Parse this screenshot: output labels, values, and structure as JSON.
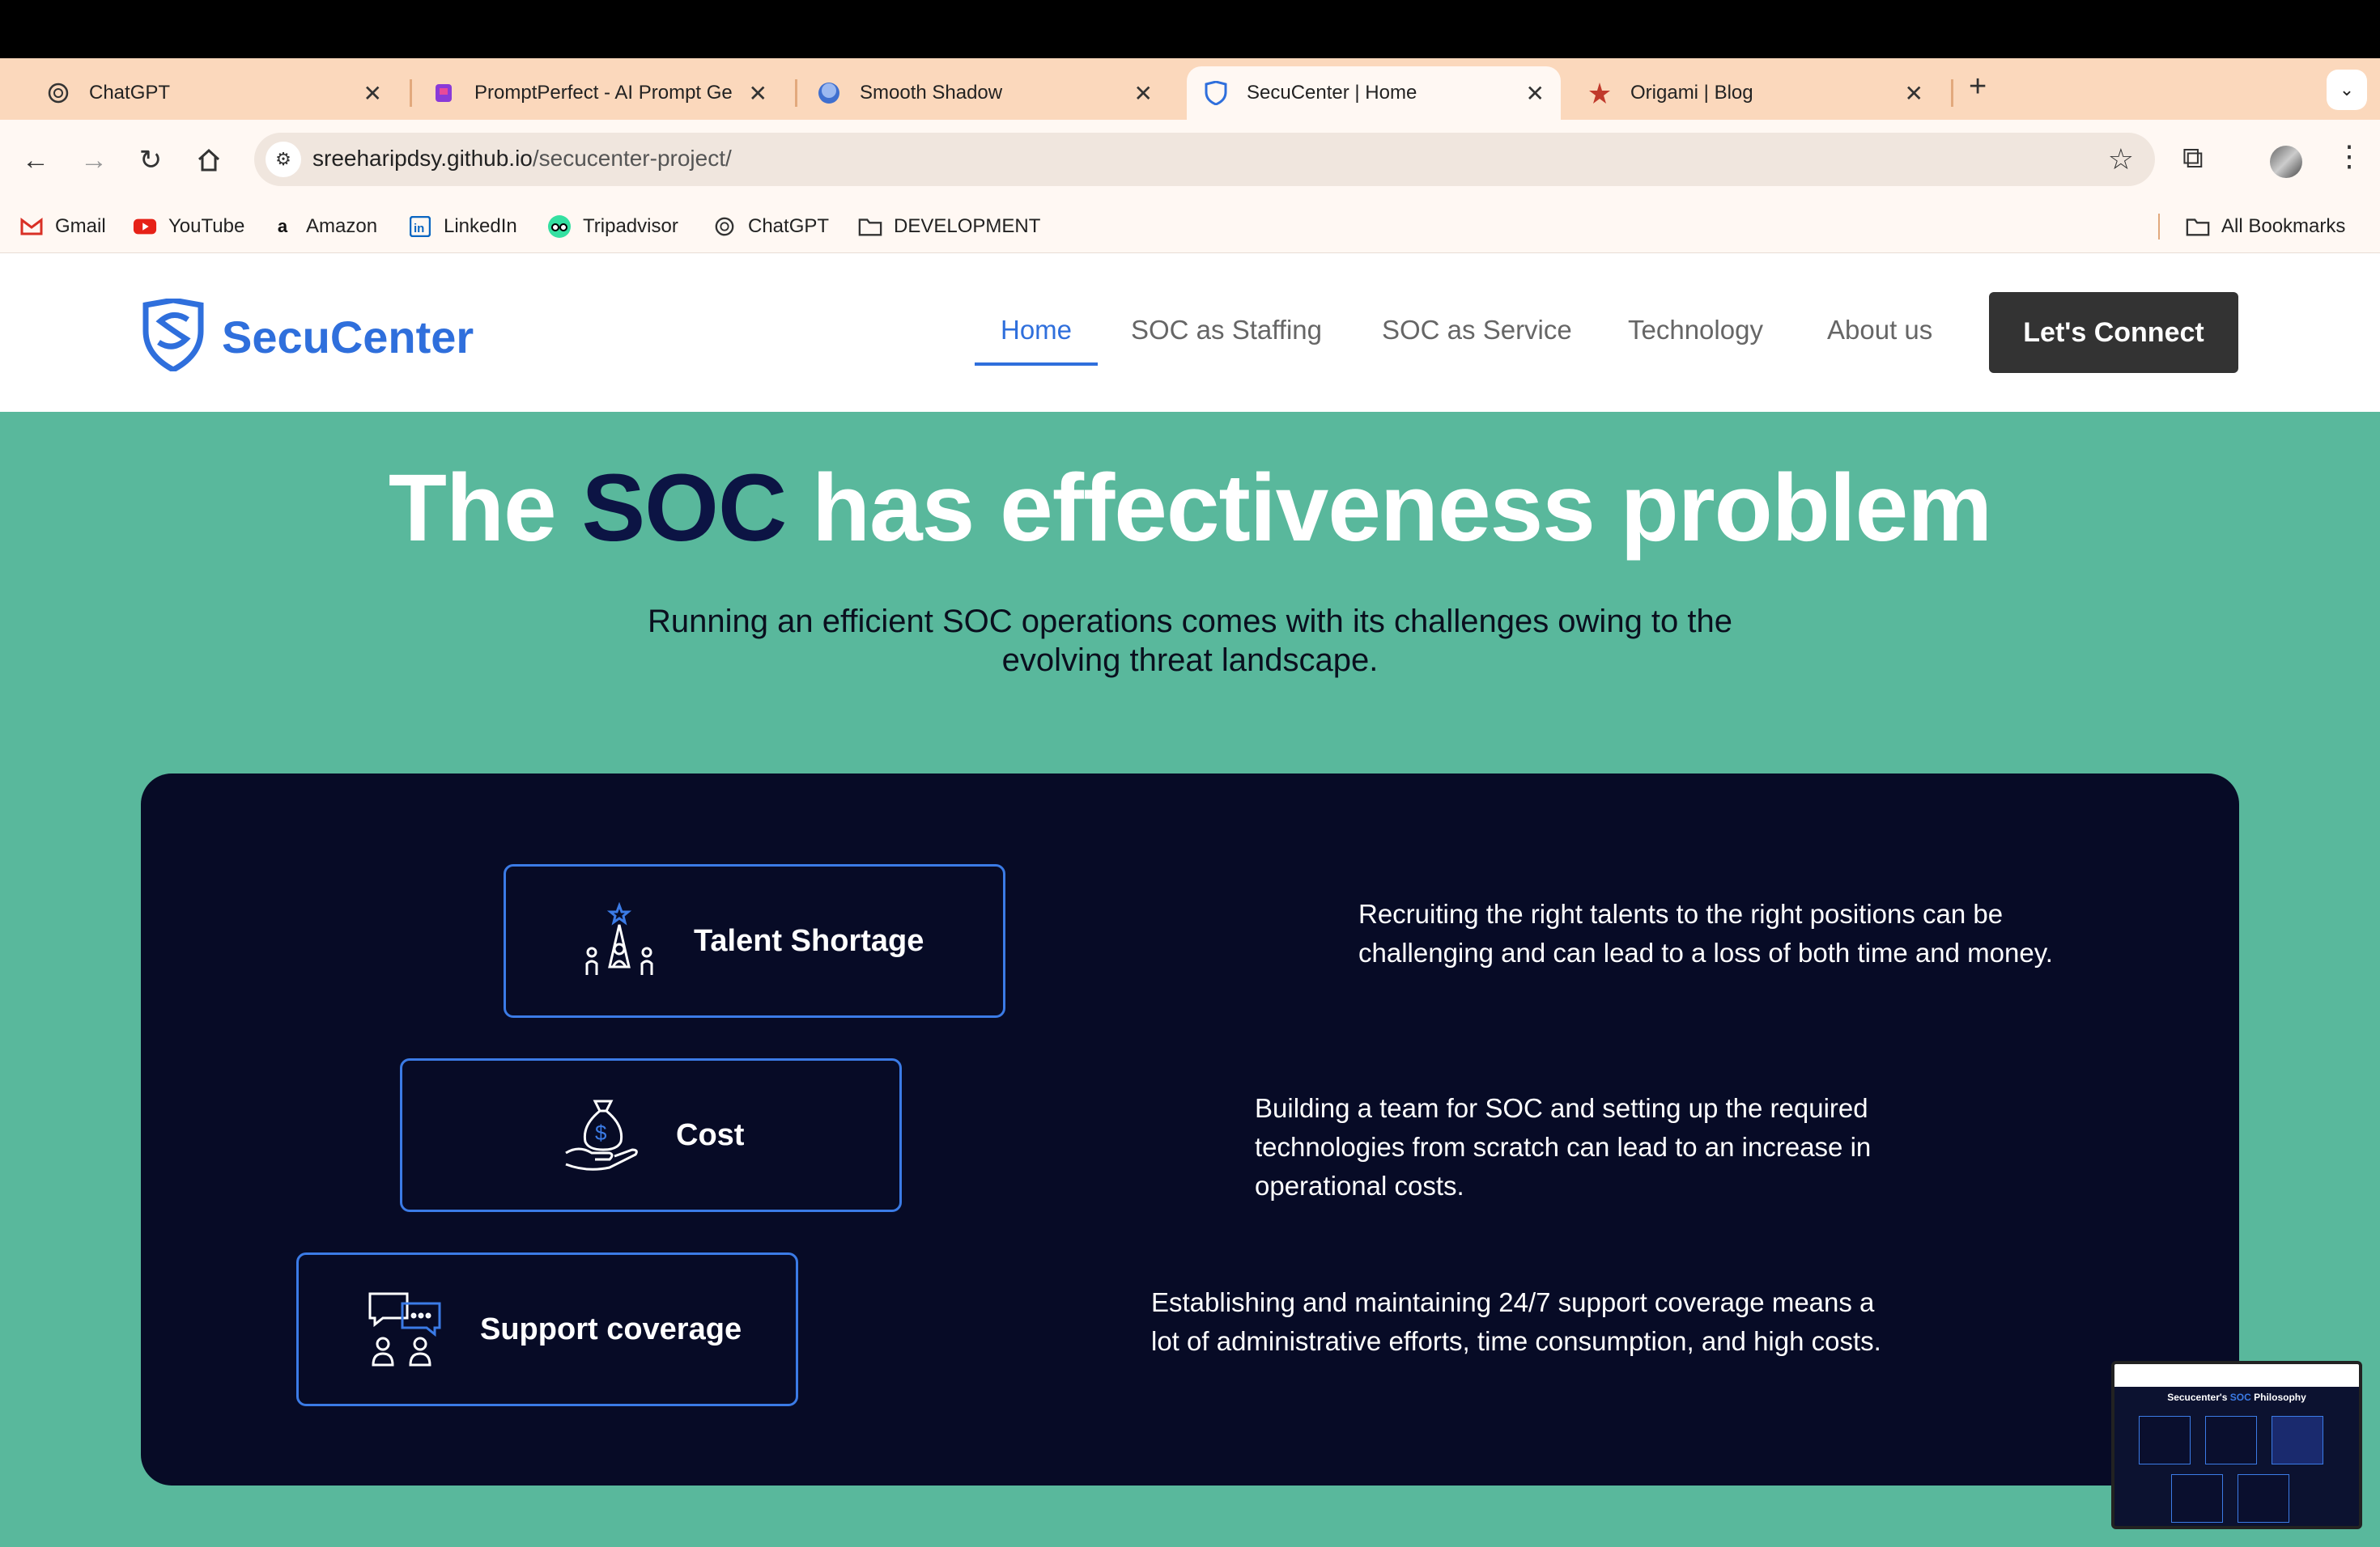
{
  "browser": {
    "tabs": [
      {
        "title": "ChatGPT",
        "icon": "chatgpt-icon"
      },
      {
        "title": "PromptPerfect - AI Prompt Ge",
        "icon": "promptperfect-icon"
      },
      {
        "title": "Smooth Shadow",
        "icon": "smooth-shadow-icon"
      },
      {
        "title": "SecuCenter | Home",
        "icon": "secucenter-icon",
        "active": true
      },
      {
        "title": "Origami | Blog",
        "icon": "origami-icon"
      }
    ],
    "url_host": "sreeharipdsy.github.io",
    "url_path": "/secucenter-project/",
    "bookmarks": [
      {
        "label": "Gmail",
        "icon": "gmail-icon"
      },
      {
        "label": "YouTube",
        "icon": "youtube-icon"
      },
      {
        "label": "Amazon",
        "icon": "amazon-icon"
      },
      {
        "label": "LinkedIn",
        "icon": "linkedin-icon"
      },
      {
        "label": "Tripadvisor",
        "icon": "tripadvisor-icon"
      },
      {
        "label": "ChatGPT",
        "icon": "chatgpt-icon"
      },
      {
        "label": "DEVELOPMENT",
        "icon": "folder-icon"
      }
    ],
    "all_bookmarks": "All Bookmarks"
  },
  "site": {
    "brand": "SecuCenter",
    "nav": [
      "Home",
      "SOC as Staffing",
      "SOC as Service",
      "Technology",
      "About us"
    ],
    "cta": "Let's Connect",
    "accent": "#2f6fdc"
  },
  "hero": {
    "title_pre": "The",
    "title_highlight": "SOC",
    "title_post": "has effectiveness problem",
    "subtitle": "Running an efficient SOC operations comes with its challenges owing to the evolving threat landscape."
  },
  "challenges": [
    {
      "title": "Talent Shortage",
      "icon": "talent-icon",
      "description": "Recruiting the right talents to the right positions can be challenging and can lead to a loss of both time and money."
    },
    {
      "title": "Cost",
      "icon": "money-bag-hand-icon",
      "description": "Building a team for SOC and setting up the required technologies from scratch can lead to an increase in operational costs."
    },
    {
      "title": "Support coverage",
      "icon": "support-chat-icon",
      "description": "Establishing and maintaining 24/7 support coverage means a lot of administrative efforts, time consumption, and high costs."
    }
  ],
  "thumbnail": {
    "title_pre": "Secucenter's",
    "title_highlight": "SOC",
    "title_post": "Philosophy"
  }
}
